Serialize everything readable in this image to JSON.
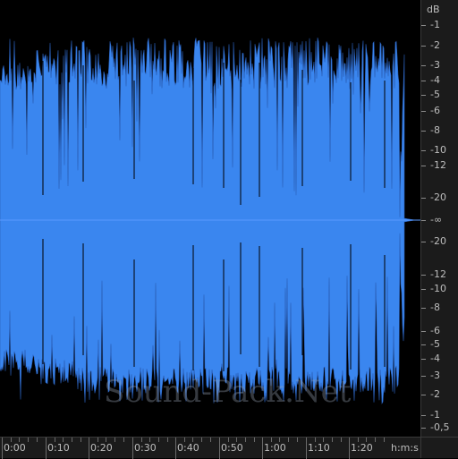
{
  "app": {
    "view": "waveform-display"
  },
  "colors": {
    "waveform": "#3a86ef",
    "waveform_dark": "#2a5fb8",
    "background": "#000000",
    "scale_bg": "#1b1b1b",
    "label": "#bdbdbd"
  },
  "db_scale": {
    "unit": "dB",
    "upper": [
      "-1",
      "-2",
      "-3",
      "-4",
      "-5",
      "-6",
      "-8",
      "-10",
      "-12",
      "-20"
    ],
    "center": "-∞",
    "lower": [
      "-20",
      "-12",
      "-10",
      "-8",
      "-6",
      "-5",
      "-4",
      "-3",
      "-2",
      "-1",
      "-0,5"
    ]
  },
  "time_ruler": {
    "labels": [
      "0:00",
      "0:10",
      "0:20",
      "0:30",
      "0:40",
      "0:50",
      "1:00",
      "1:10",
      "1:20"
    ],
    "unit": "h:m:s"
  },
  "watermark": "Sound-Pack.Net"
}
